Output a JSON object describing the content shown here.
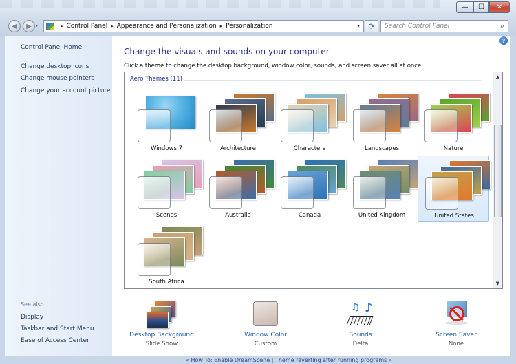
{
  "toolbar": {
    "back_label": "◀",
    "forward_label": "▶",
    "history_label": "▾",
    "refresh_label": "⟳",
    "search_placeholder": "Search Control Panel"
  },
  "window_controls": {
    "minimize": "—",
    "maximize": "☐",
    "close": "✕"
  },
  "address_bar": {
    "breadcrumbs": [
      "Control Panel",
      "Appearance and Personalization",
      "Personalization"
    ],
    "separator": "▸",
    "dropdown_label": "▾"
  },
  "sidebar": {
    "home": "Control Panel Home",
    "links": [
      "Change desktop icons",
      "Change mouse pointers",
      "Change your account picture"
    ],
    "see_also_label": "See also",
    "see_also": [
      "Display",
      "Taskbar and Start Menu",
      "Ease of Access Center"
    ]
  },
  "main": {
    "help_label": "?",
    "title": "Change the visuals and sounds on your computer",
    "description": "Click a theme to change the desktop background, window color, sounds, and screen saver all at once.",
    "group_label": "Aero Themes (11)",
    "scroll_up": "▲",
    "scroll_down": "▼",
    "themes": [
      {
        "name": "Windows 7",
        "colors": [
          "#1f86c8",
          "#5cb7e6",
          "#9ed6f2"
        ],
        "selected": false
      },
      {
        "name": "Architecture",
        "colors": [
          "#c97a2a",
          "#5a6e8a",
          "#2c3a52"
        ],
        "selected": false
      },
      {
        "name": "Characters",
        "colors": [
          "#7cc1e0",
          "#d6a06a",
          "#e6d3b3"
        ],
        "selected": false
      },
      {
        "name": "Landscapes",
        "colors": [
          "#d8833d",
          "#9a6a8c",
          "#5f7d98"
        ],
        "selected": false
      },
      {
        "name": "Nature",
        "colors": [
          "#e0405a",
          "#59a52e",
          "#9fd24a"
        ],
        "selected": false
      },
      {
        "name": "Scenes",
        "colors": [
          "#d9c3e6",
          "#e8a0b8",
          "#7fcfa0"
        ],
        "selected": false
      },
      {
        "name": "Australia",
        "colors": [
          "#3c6fa8",
          "#3f8a3a",
          "#b55a2a"
        ],
        "selected": false
      },
      {
        "name": "Canada",
        "colors": [
          "#2d72b8",
          "#4d8a5c",
          "#6aa3d8"
        ],
        "selected": false
      },
      {
        "name": "United Kingdom",
        "colors": [
          "#5b7fb5",
          "#c4a47a",
          "#6f8f6a"
        ],
        "selected": false
      },
      {
        "name": "United States",
        "colors": [
          "#e0782e",
          "#3d6a9a",
          "#c2a24c"
        ],
        "selected": true
      },
      {
        "name": "South Africa",
        "colors": [
          "#7a8a5a",
          "#c7a070",
          "#d6b48c"
        ],
        "selected": false
      }
    ]
  },
  "settings": [
    {
      "label": "Desktop Background",
      "value": "Slide Show",
      "icon": "desktop-background-icon"
    },
    {
      "label": "Window Color",
      "value": "Custom",
      "icon": "window-color-icon"
    },
    {
      "label": "Sounds",
      "value": "Delta",
      "icon": "sounds-icon"
    },
    {
      "label": "Screen Saver",
      "value": "None",
      "icon": "screen-saver-icon"
    }
  ],
  "colors": {
    "link": "#2060b0",
    "title": "#1e3287",
    "sidebar_link": "#1e395b",
    "window_color_swatch": "#d9c9c3",
    "selection": "#d9e9fa"
  },
  "footer_text": "« How To: Enable DreamScene | Theme reverting after running programs »"
}
